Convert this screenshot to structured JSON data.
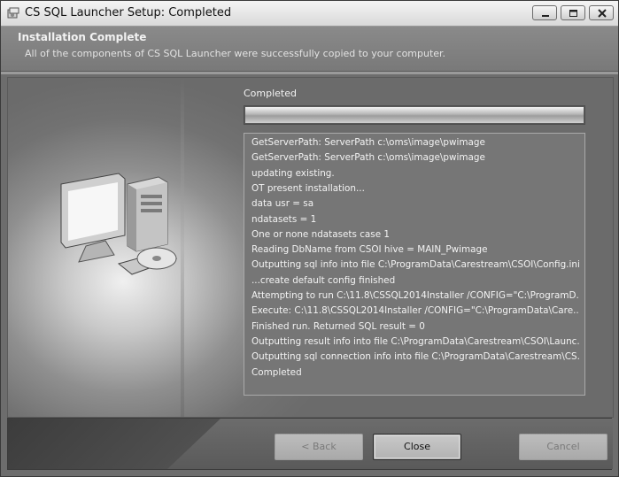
{
  "window": {
    "title": "CS SQL Launcher Setup: Completed"
  },
  "header": {
    "title": "Installation Complete",
    "subtitle": "All of the components of CS SQL Launcher were successfully copied to your computer."
  },
  "progress": {
    "label": "Completed",
    "value_percent": 100
  },
  "log": {
    "lines": [
      "GetServerPath: ServerPath c:\\oms\\image\\pwimage",
      "GetServerPath: ServerPath c:\\oms\\image\\pwimage",
      "updating existing.",
      "OT present installation...",
      "data usr = sa",
      "ndatasets = 1",
      "One or none ndatasets case  1",
      "Reading DbName from CSOI hive = MAIN_Pwimage",
      "Outputting sql info into file C:\\ProgramData\\Carestream\\CSOI\\Config.ini",
      "...create default config finished",
      "Attempting to run C:\\11.8\\CSSQL2014Installer /CONFIG=\"C:\\ProgramD...",
      "Execute: C:\\11.8\\CSSQL2014Installer /CONFIG=\"C:\\ProgramData\\Care...",
      "Finished run. Returned SQL result = 0",
      "Outputting result info into file C:\\ProgramData\\Carestream\\CSOI\\Launc...",
      "Outputting sql connection info into file C:\\ProgramData\\Carestream\\CS...",
      "Completed"
    ]
  },
  "buttons": {
    "back": "< Back",
    "close": "Close",
    "cancel": "Cancel"
  },
  "icons": {
    "app": "installer-icon",
    "illustration": "computer-with-disc-illustration"
  }
}
